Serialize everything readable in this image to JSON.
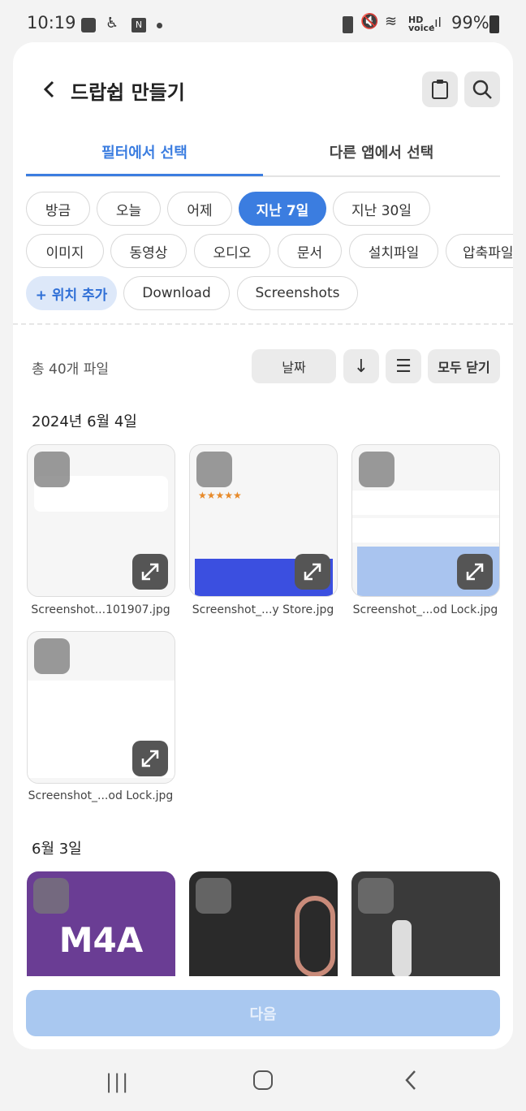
{
  "status_bar": {
    "time": "10:19",
    "battery": "99%"
  },
  "header": {
    "title": "드랍쉽 만들기"
  },
  "tabs": [
    {
      "label": "필터에서 선택",
      "active": true
    },
    {
      "label": "다른 앱에서 선택",
      "active": false
    }
  ],
  "time_filters": [
    "방금",
    "오늘",
    "어제",
    "지난 7일",
    "지난 30일"
  ],
  "selected_time_filter": "지난 7일",
  "type_filters": [
    "이미지",
    "동영상",
    "오디오",
    "문서",
    "설치파일",
    "압축파일"
  ],
  "location": {
    "add_label": "+ 위치 추가",
    "items": [
      "Download",
      "Screenshots"
    ]
  },
  "toolbar": {
    "count": "총 40개 파일",
    "sort": "날짜",
    "collapse": "모두 닫기"
  },
  "groups": [
    {
      "date": "2024년 6월 4일",
      "files": [
        "Screenshot...101907.jpg",
        "Screenshot_...y Store.jpg",
        "Screenshot_...od Lock.jpg",
        "Screenshot_...od Lock.jpg"
      ]
    },
    {
      "date": "6월 3일",
      "files": [
        "M4A",
        "",
        ""
      ]
    }
  ],
  "next_button": "다음",
  "colors": {
    "accent": "#3b7de0",
    "next_disabled": "#a9c8f0",
    "m4a": "#6a3d94"
  }
}
